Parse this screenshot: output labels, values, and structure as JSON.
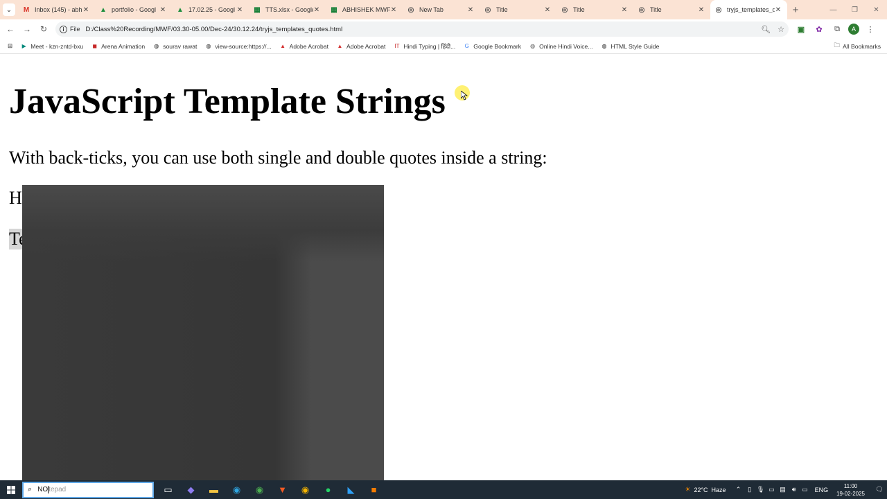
{
  "browser": {
    "tabs": [
      {
        "label": "Inbox (145) - abh",
        "icon": "gmail-icon",
        "color": "#d93025",
        "active": false
      },
      {
        "label": "portfolio - Googl",
        "icon": "drive-icon",
        "color": "#1e8e3e",
        "active": false
      },
      {
        "label": "17.02.25 - Googl",
        "icon": "drive-icon",
        "color": "#1e8e3e",
        "active": false
      },
      {
        "label": "TTS.xlsx - Google",
        "icon": "sheets-icon",
        "color": "#188038",
        "active": false
      },
      {
        "label": "ABHISHEK MWF",
        "icon": "sheets-icon",
        "color": "#188038",
        "active": false
      },
      {
        "label": "New Tab",
        "icon": "chrome-icon",
        "color": "#555555",
        "active": false
      },
      {
        "label": "Title",
        "icon": "globe-icon",
        "color": "#555555",
        "active": false
      },
      {
        "label": "Title",
        "icon": "globe-icon",
        "color": "#555555",
        "active": false
      },
      {
        "label": "Title",
        "icon": "globe-icon",
        "color": "#555555",
        "active": false
      },
      {
        "label": "tryjs_templates_q",
        "icon": "globe-icon",
        "color": "#555555",
        "active": true
      }
    ],
    "omnibox": {
      "chip_label": "File",
      "url": "D:/Class%20Recording/MWF/03.30-05.00/Dec-24/30.12.24/tryjs_templates_quotes.html"
    },
    "bookmarks": [
      {
        "label": "Meet - kzn-zntd-bxu",
        "icon": "meet-icon",
        "color": "#00897b"
      },
      {
        "label": "Arena Animation",
        "icon": "arena-icon",
        "color": "#c62828"
      },
      {
        "label": "sourav rawat",
        "icon": "globe-icon",
        "color": "#222222"
      },
      {
        "label": "view-source:https://...",
        "icon": "globe-icon",
        "color": "#222222"
      },
      {
        "label": "Adobe Acrobat",
        "icon": "acrobat-icon",
        "color": "#d32f2f"
      },
      {
        "label": "Adobe Acrobat",
        "icon": "acrobat-icon",
        "color": "#d32f2f"
      },
      {
        "label": "Hindi Typing | हिंदी...",
        "icon": "typing-icon",
        "color": "#c62828"
      },
      {
        "label": "Google Bookmark",
        "icon": "google-icon",
        "color": "#4285f4"
      },
      {
        "label": "Online Hindi Voice...",
        "icon": "voice-icon",
        "color": "#555555"
      },
      {
        "label": "HTML Style Guide",
        "icon": "globe-icon",
        "color": "#222222"
      }
    ],
    "all_bookmarks_label": "All Bookmarks"
  },
  "page": {
    "heading": "JavaScript Template Strings",
    "intro": "With back-ticks, you can use both single and double quotes inside a string:",
    "line2_visible": "H",
    "line3_visible": "Te"
  },
  "taskbar": {
    "search_typed": "NO",
    "search_suggestion": "tepad",
    "apps": [
      {
        "icon": "task-view-icon",
        "glyph": "▭",
        "color": "#ffffff"
      },
      {
        "icon": "copilot-icon",
        "glyph": "◆",
        "color": "#8e7cf0"
      },
      {
        "icon": "file-explorer-icon",
        "glyph": "▬",
        "color": "#f4c542"
      },
      {
        "icon": "edge-icon",
        "glyph": "◉",
        "color": "#2fa5e0"
      },
      {
        "icon": "chrome-icon",
        "glyph": "◉",
        "color": "#4caf50"
      },
      {
        "icon": "brave-icon",
        "glyph": "▼",
        "color": "#f15a24"
      },
      {
        "icon": "chrome-icon",
        "glyph": "◉",
        "color": "#f4b400"
      },
      {
        "icon": "whatsapp-icon",
        "glyph": "●",
        "color": "#25d366"
      },
      {
        "icon": "vscode-icon",
        "glyph": "◣",
        "color": "#2ea0f5"
      },
      {
        "icon": "app-icon",
        "glyph": "■",
        "color": "#f57c00"
      }
    ],
    "weather_temp": "22°C",
    "weather_desc": "Haze",
    "language": "ENG",
    "time": "11:00",
    "date": "19-02-2025"
  }
}
